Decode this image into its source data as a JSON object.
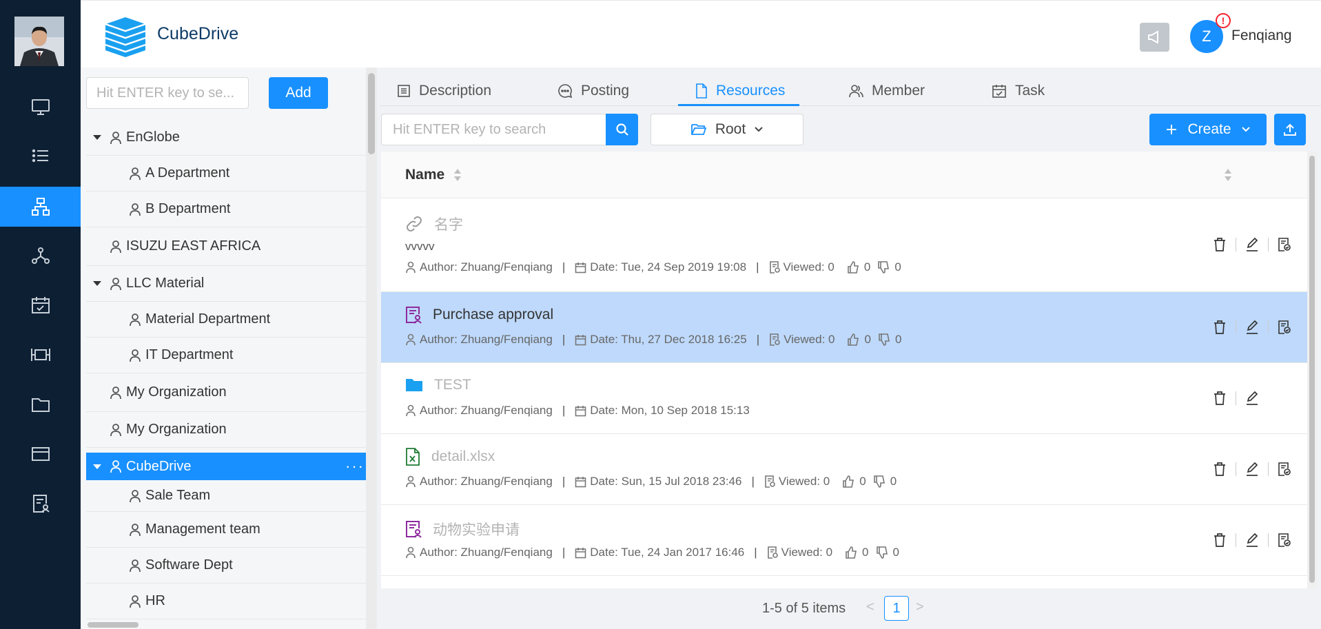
{
  "header": {
    "brand": "CubeDrive",
    "user_initial": "Z",
    "alert_badge": "!",
    "user_name": "Fenqiang"
  },
  "sidebar": {
    "items": [
      {
        "icon": "monitor-icon"
      },
      {
        "icon": "list-icon"
      },
      {
        "icon": "org-chart-icon",
        "active": true
      },
      {
        "icon": "network-icon"
      },
      {
        "icon": "calendar-check-icon"
      },
      {
        "icon": "projector-icon"
      },
      {
        "icon": "folder-icon"
      },
      {
        "icon": "card-icon"
      },
      {
        "icon": "document-user-icon"
      }
    ]
  },
  "tree": {
    "search_placeholder": "Hit ENTER key to se...",
    "add_label": "Add",
    "nodes": [
      {
        "label": "EnGlobe"
      },
      {
        "label": "A Department"
      },
      {
        "label": "B Department"
      },
      {
        "label": "ISUZU EAST AFRICA"
      },
      {
        "label": "LLC Material"
      },
      {
        "label": "Material Department"
      },
      {
        "label": "IT Department"
      },
      {
        "label": "My Organization"
      },
      {
        "label": "My Organization"
      },
      {
        "label": "CubeDrive",
        "more": "···"
      },
      {
        "label": "Sale Team"
      },
      {
        "label": "Management team"
      },
      {
        "label": "Software Dept"
      },
      {
        "label": "HR"
      }
    ]
  },
  "tabs": [
    {
      "label": "Description"
    },
    {
      "label": "Posting"
    },
    {
      "label": "Resources",
      "active": true
    },
    {
      "label": "Member"
    },
    {
      "label": "Task"
    }
  ],
  "toolbar": {
    "search_placeholder": "Hit ENTER key to search",
    "root_label": "Root",
    "create_label": "Create"
  },
  "table": {
    "name_header": "Name",
    "rows": [
      {
        "icon": "link-icon",
        "title": "名字",
        "desc": "vvvvv",
        "author": "Author: Zhuang/Fenqiang",
        "date": "Date: Tue, 24 Sep 2019 19:08",
        "viewed": "Viewed: 0",
        "likes": "0",
        "dislikes": "0"
      },
      {
        "icon": "approval-form-icon",
        "title": "Purchase approval",
        "author": "Author: Zhuang/Fenqiang",
        "date": "Date: Thu, 27 Dec 2018 16:25",
        "viewed": "Viewed: 0",
        "likes": "0",
        "dislikes": "0"
      },
      {
        "icon": "folder-icon",
        "title": "TEST",
        "author": "Author: Zhuang/Fenqiang",
        "date": "Date: Mon, 10 Sep 2018 15:13"
      },
      {
        "icon": "excel-file-icon",
        "title": "detail.xlsx",
        "author": "Author: Zhuang/Fenqiang",
        "date": "Date: Sun, 15 Jul 2018 23:46",
        "viewed": "Viewed: 0",
        "likes": "0",
        "dislikes": "0"
      },
      {
        "icon": "approval-form-icon",
        "title": "动物实验申请",
        "author": "Author: Zhuang/Fenqiang",
        "date": "Date: Tue, 24 Jan 2017 16:46",
        "viewed": "Viewed: 0",
        "likes": "0",
        "dislikes": "0"
      }
    ]
  },
  "pagination": {
    "summary": "1-5 of 5 items",
    "prev": "<",
    "current": "1",
    "next": ">"
  },
  "colors": {
    "primary": "#1890ff",
    "sidebar_bg": "#0d1f33",
    "highlight_row": "#bed9fb"
  }
}
